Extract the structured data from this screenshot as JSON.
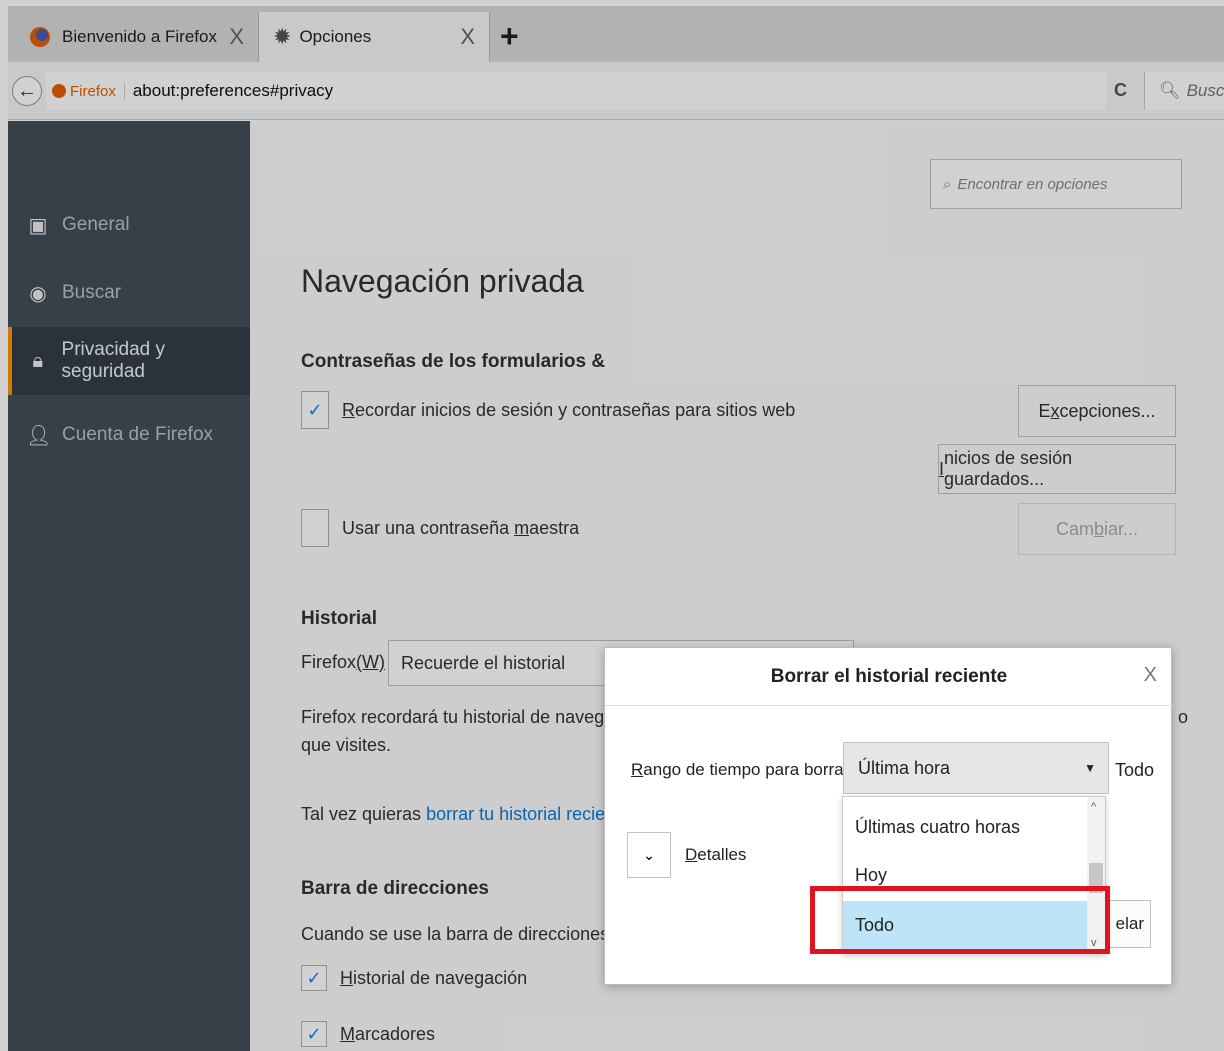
{
  "tabs": [
    {
      "label": "Bienvenido a Firefox",
      "icon": "firefox-logo-icon"
    },
    {
      "label": "Opciones",
      "icon": "gear-icon"
    }
  ],
  "tab_close": "X",
  "new_tab": "+",
  "navbar": {
    "identity_label": "Firefox",
    "url": "about:preferences#privacy",
    "reload": "C",
    "search_placeholder": "Buscar"
  },
  "sidebar": {
    "items": [
      {
        "label": "General",
        "icon": "general-icon"
      },
      {
        "label": "Buscar",
        "icon": "search-icon"
      },
      {
        "label": "Privacidad y seguridad",
        "icon": "lock-icon"
      },
      {
        "label": "Cuenta de Firefox",
        "icon": "account-icon"
      }
    ],
    "selected": "Privacidad y seguridad"
  },
  "main": {
    "find_placeholder": "Encontrar en opciones",
    "page_title": "Navegación privada",
    "forms_header": "Contraseñas de los formularios &",
    "remember_logins": {
      "prefix": "",
      "accel": "R",
      "rest": "ecordar inicios de sesión y contraseñas para sitios web"
    },
    "exceptions_btn": {
      "prefix": "E",
      "accel": "x",
      "rest": "cepciones..."
    },
    "saved_logins_btn": {
      "accel": "I",
      "rest": "nicios de sesión guardados..."
    },
    "master_password": {
      "prefix": "Usar una contraseña ",
      "accel": "m",
      "rest": "aestra"
    },
    "change_btn": {
      "prefix": "Cam",
      "accel": "b",
      "rest": "iar..."
    },
    "history_header": "Historial",
    "firefox_will_prefix": "Firefox ",
    "firefox_will_accel": "(W)",
    "history_mode": "Recuerde el historial",
    "history_desc_1": "Firefox recordará tu historial de navegacio",
    "history_desc_2": "que visites.",
    "history_desc_tail": "o",
    "clear_prefix": "Tal vez quieras ",
    "clear_link": "borrar tu historial reciente,",
    "address_bar_header": "Barra de direcciones",
    "address_bar_desc": "Cuando se use la barra de direcciones, sug",
    "suggest_history": {
      "accel": "H",
      "rest": "istorial de navegación"
    },
    "suggest_bookmarks": {
      "accel": "M",
      "rest": "arcadores"
    }
  },
  "dialog": {
    "title": "Borrar el historial reciente",
    "close": "X",
    "range_label_accel": "R",
    "range_label_rest": "ango de tiempo para borrar:",
    "selected_value": "Última hora",
    "tail_text": "Todo",
    "details_prefix": "",
    "details_accel": "D",
    "details_rest": "etalles",
    "cancel_partial": "elar"
  },
  "dropdown": {
    "options": [
      "Últimas cuatro horas",
      "Hoy",
      "Todo"
    ],
    "highlighted": "Todo",
    "highlight_color": "#e0141e"
  }
}
